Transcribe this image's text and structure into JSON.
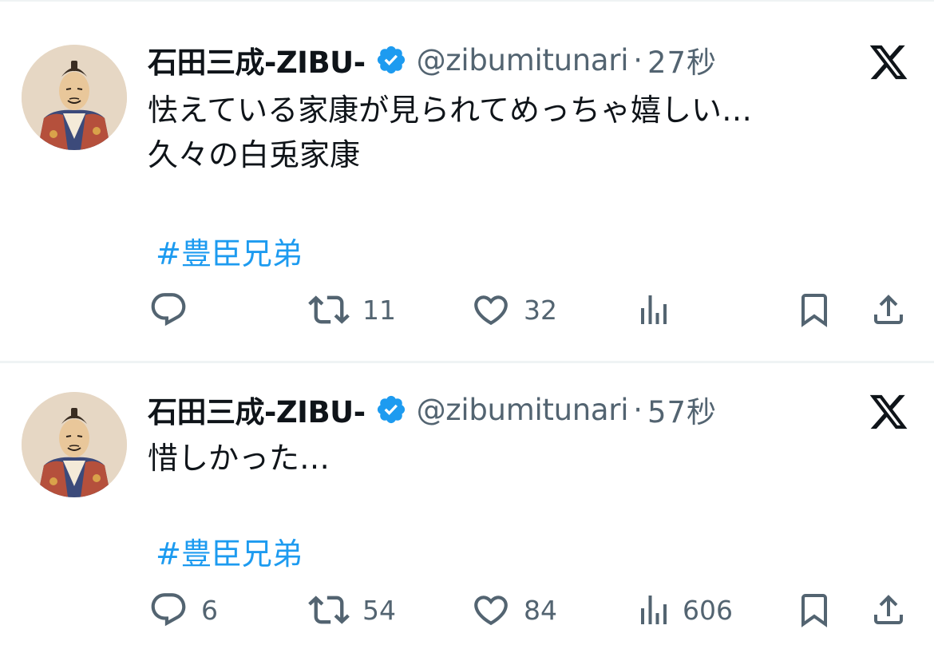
{
  "tweets": [
    {
      "display_name": "石田三成-ZIBU-",
      "handle": "@zibumitunari",
      "separator": "·",
      "time": "27秒",
      "text": "怯えている家康が見られてめっちゃ嬉しい…\n久々の白兎家康",
      "hashtag": "#豊臣兄弟",
      "counts": {
        "reply": "",
        "retweet": "11",
        "like": "32",
        "views": ""
      }
    },
    {
      "display_name": "石田三成-ZIBU-",
      "handle": "@zibumitunari",
      "separator": "·",
      "time": "57秒",
      "text": "惜しかった…",
      "hashtag": "#豊臣兄弟",
      "counts": {
        "reply": "6",
        "retweet": "54",
        "like": "84",
        "views": "606"
      }
    }
  ],
  "icons": {
    "verified": "verified-badge-icon",
    "platform": "x-logo-icon",
    "reply": "reply-icon",
    "retweet": "retweet-icon",
    "like": "heart-icon",
    "views": "views-icon",
    "bookmark": "bookmark-icon",
    "share": "share-icon"
  },
  "colors": {
    "text": "#0f1419",
    "secondary": "#536471",
    "hashtag": "#1d9bf0",
    "verified": "#1d9bf0",
    "divider": "#eff3f4"
  }
}
